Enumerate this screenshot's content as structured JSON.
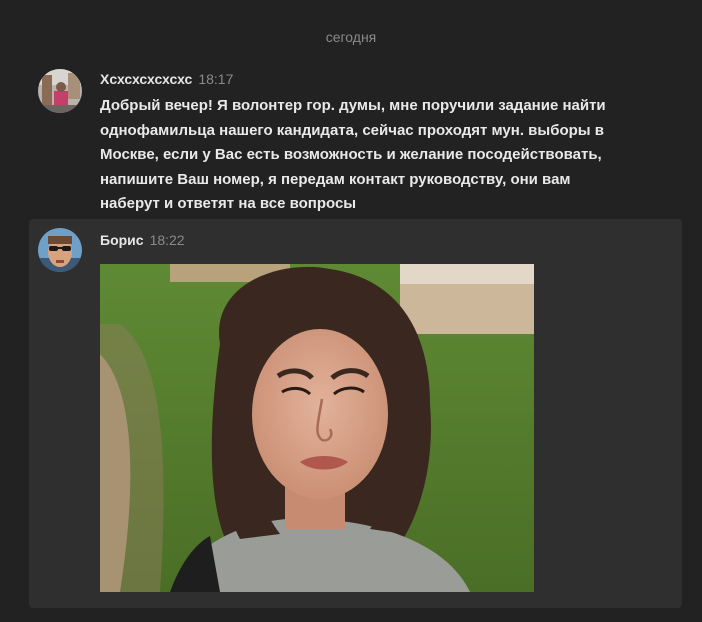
{
  "chat": {
    "date_separator": "сегодня",
    "messages": [
      {
        "author": "Хсхсхсхсхсхс",
        "time": "18:17",
        "text_lines": [
          "Добрый вечер! Я волонтер гор. думы, мне поручили задание найти",
          "однофамильца нашего кандидата, сейчас проходят мун. выборы в",
          "Москве, если у Вас есть возможность и желание посодействовать,",
          "напишите Ваш номер, я передам контакт руководству, они вам",
          "наберут и ответят на все вопросы"
        ]
      },
      {
        "author": "Борис",
        "time": "18:22",
        "attachment": "photo"
      }
    ]
  },
  "colors": {
    "background": "#222222",
    "highlight_background": "#2f2f2f",
    "text": "#e9e9e9",
    "muted": "#8a8a8a"
  }
}
